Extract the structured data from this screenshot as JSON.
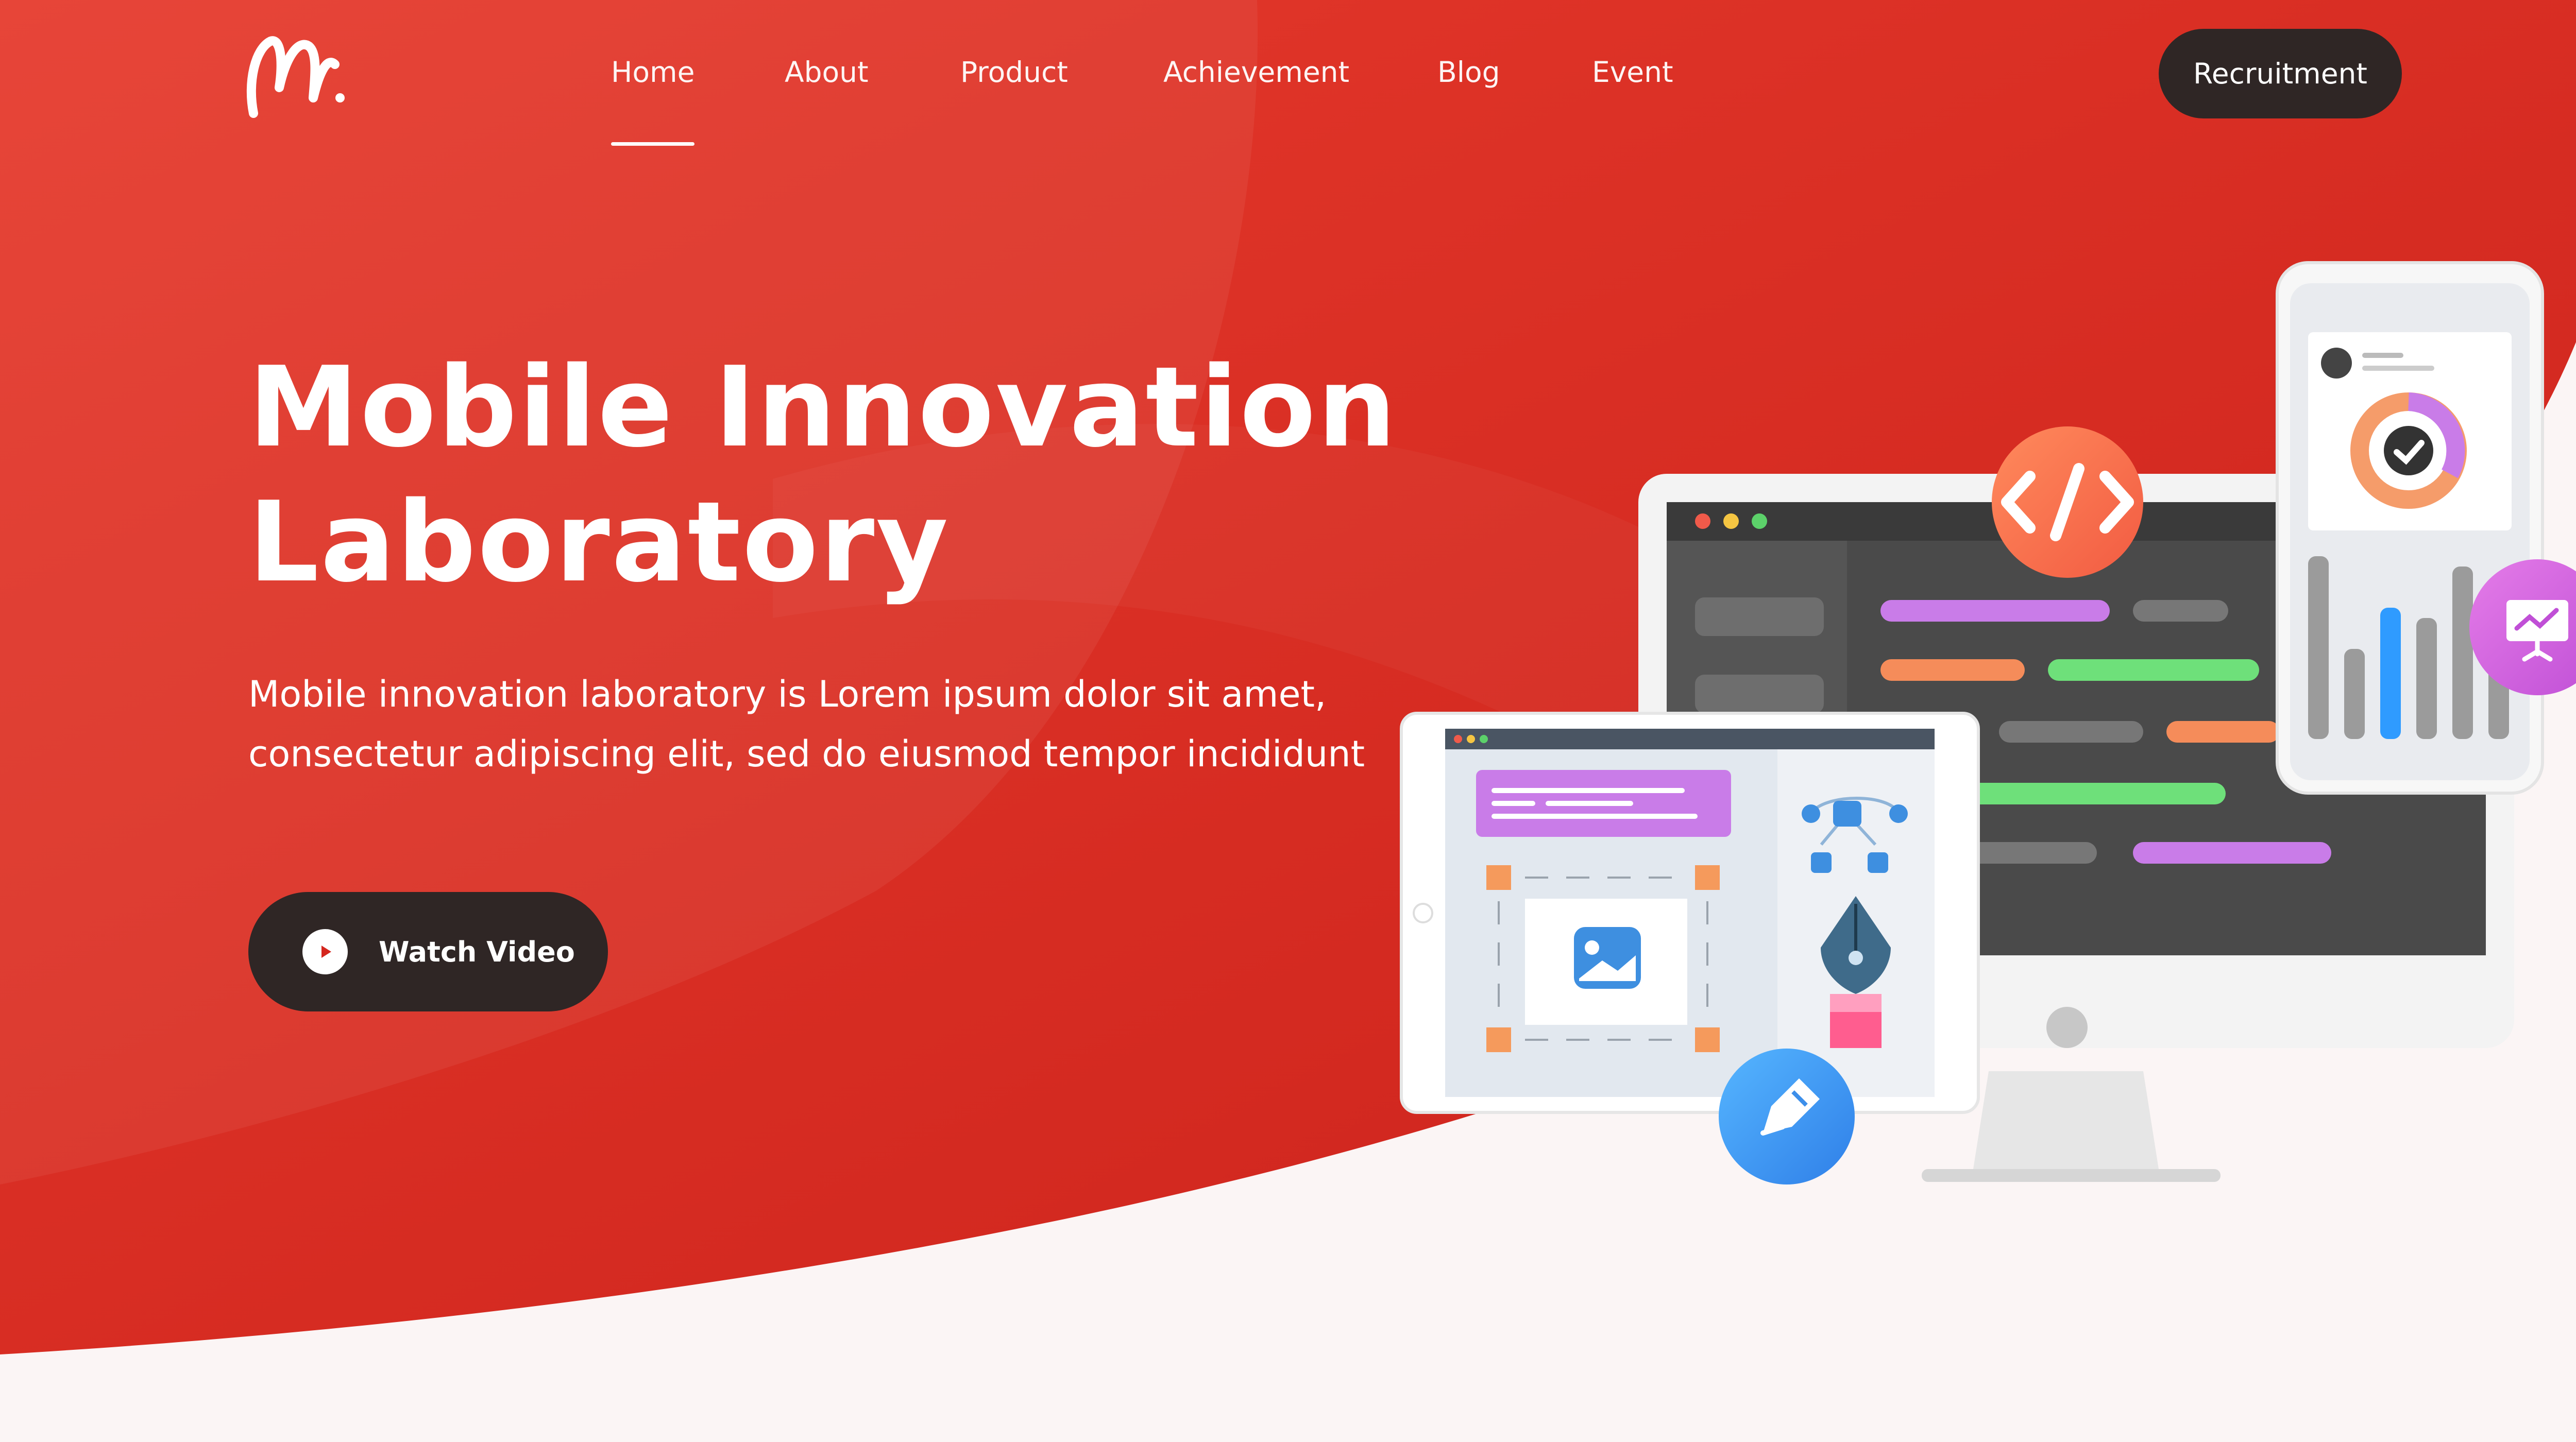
{
  "colors": {
    "hero_red": "#d4261e",
    "hero_red_light": "#e63a2c",
    "dark_button": "#2f2625",
    "page_background": "#fbf5f5",
    "white": "#ffffff"
  },
  "header": {
    "logo_icon": "script-m-logo",
    "nav": [
      {
        "label": "Home",
        "active": true
      },
      {
        "label": "About",
        "active": false
      },
      {
        "label": "Product",
        "active": false
      },
      {
        "label": "Achievement",
        "active": false
      },
      {
        "label": "Blog",
        "active": false
      },
      {
        "label": "Event",
        "active": false
      }
    ],
    "cta_label": "Recruitment"
  },
  "hero": {
    "title_line1": "Mobile Innovation",
    "title_line2": "Laboratory",
    "description_line1": "Mobile innovation laboratory is Lorem ipsum dolor sit amet,",
    "description_line2": "consectetur adipiscing elit, sed do eiusmod tempor incididunt",
    "watch_button_label": "Watch Video",
    "watch_button_icon": "play-icon"
  },
  "illustration": {
    "icons": [
      "code-icon",
      "presentation-chart-icon",
      "pen-tool-icon",
      "edit-icon",
      "image-icon",
      "donut-chart-icon",
      "vector-nodes-icon"
    ]
  }
}
